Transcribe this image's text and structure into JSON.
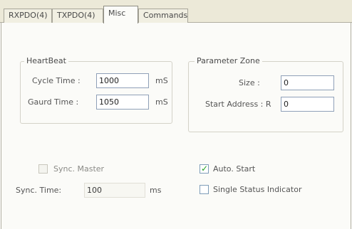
{
  "tabs": [
    {
      "label": "RXPDO(4)"
    },
    {
      "label": "TXPDO(4)"
    },
    {
      "label": "Misc"
    },
    {
      "label": "Commands"
    }
  ],
  "heartbeat": {
    "title": "HeartBeat",
    "cycle_time_label": "Cycle Time :",
    "cycle_time_value": "1000",
    "cycle_time_unit": "mS",
    "guard_time_label": "Gaurd Time :",
    "guard_time_value": "1050",
    "guard_time_unit": "mS"
  },
  "parameter_zone": {
    "title": "Parameter Zone",
    "size_label": "Size :",
    "size_value": "0",
    "start_address_label": "Start Address : R",
    "start_address_value": "0"
  },
  "sync": {
    "master_label": "Sync. Master",
    "master_checked": false,
    "time_label": "Sync. Time:",
    "time_value": "100",
    "time_unit": "ms"
  },
  "options": {
    "auto_start_label": "Auto. Start",
    "auto_start_checked": true,
    "single_status_label": "Single Status Indicator",
    "single_status_checked": false
  },
  "colors": {
    "checkmark": "#21a121",
    "input_border": "#8fa0b8",
    "tab_strip": "#ece9d8"
  }
}
